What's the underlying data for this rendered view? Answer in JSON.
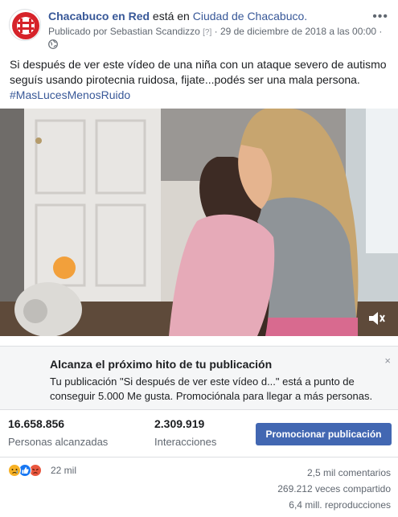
{
  "header": {
    "page_name": "Chacabuco en Red",
    "connector": " está en ",
    "place": "Ciudad de Chacabuco.",
    "published_by": "Publicado por Sebastian Scandizzo",
    "help_marker": "[?]",
    "date": "· 29 de diciembre de 2018 a las 00:00 ·",
    "menu_icon": "more-dots-icon",
    "audience_icon": "globe-icon"
  },
  "post": {
    "text": "Si después de ver este vídeo de una niña con un ataque severo de autismo seguís usando pirotecnia ruidosa, fijate...podés ser una mala persona. ",
    "hashtag": "#MasLucesMenosRuido"
  },
  "video": {
    "volume_icon": "volume-icon"
  },
  "promo": {
    "title": "Alcanza el próximo hito de tu publicación",
    "body": "Tu publicación \"Si después de ver este vídeo d...\" está a punto de conseguir 5.000 Me gusta. Promociónala para llegar a más personas.",
    "close": "×"
  },
  "stats": {
    "reach_value": "16.658.856",
    "reach_label": "Personas alcanzadas",
    "interactions_value": "2.309.919",
    "interactions_label": "Interacciones",
    "promote_button": "Promocionar publicación"
  },
  "engagement": {
    "reactions_count": "22 mil",
    "comments": "2,5 mil comentarios",
    "shares": "269.212 veces compartido",
    "views": "6,4 mill. reproducciones"
  },
  "colors": {
    "link": "#385898",
    "button": "#4267b2",
    "brand_red": "#d6232a"
  }
}
